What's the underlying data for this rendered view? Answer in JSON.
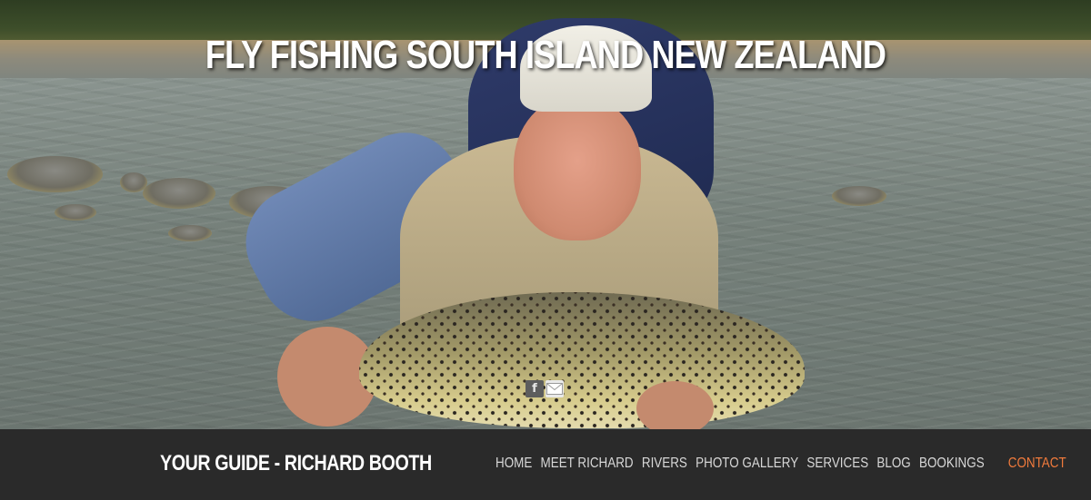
{
  "hero": {
    "title": "FLY FISHING SOUTH ISLAND NEW ZEALAND"
  },
  "social": {
    "facebook_icon": "facebook-icon",
    "facebook_glyph": "f",
    "email_icon": "envelope-icon"
  },
  "footer": {
    "guide_label": "YOUR GUIDE - RICHARD BOOTH",
    "nav": [
      {
        "label": "HOME"
      },
      {
        "label": "MEET RICHARD"
      },
      {
        "label": "RIVERS"
      },
      {
        "label": "PHOTO GALLERY"
      },
      {
        "label": "SERVICES"
      },
      {
        "label": "BLOG"
      },
      {
        "label": "BOOKINGS"
      },
      {
        "label": "CONTACT"
      }
    ],
    "active_item": "CONTACT",
    "colors": {
      "background": "#2a2a2a",
      "nav_text": "#d8d8d8",
      "active": "#f07a3c"
    }
  }
}
